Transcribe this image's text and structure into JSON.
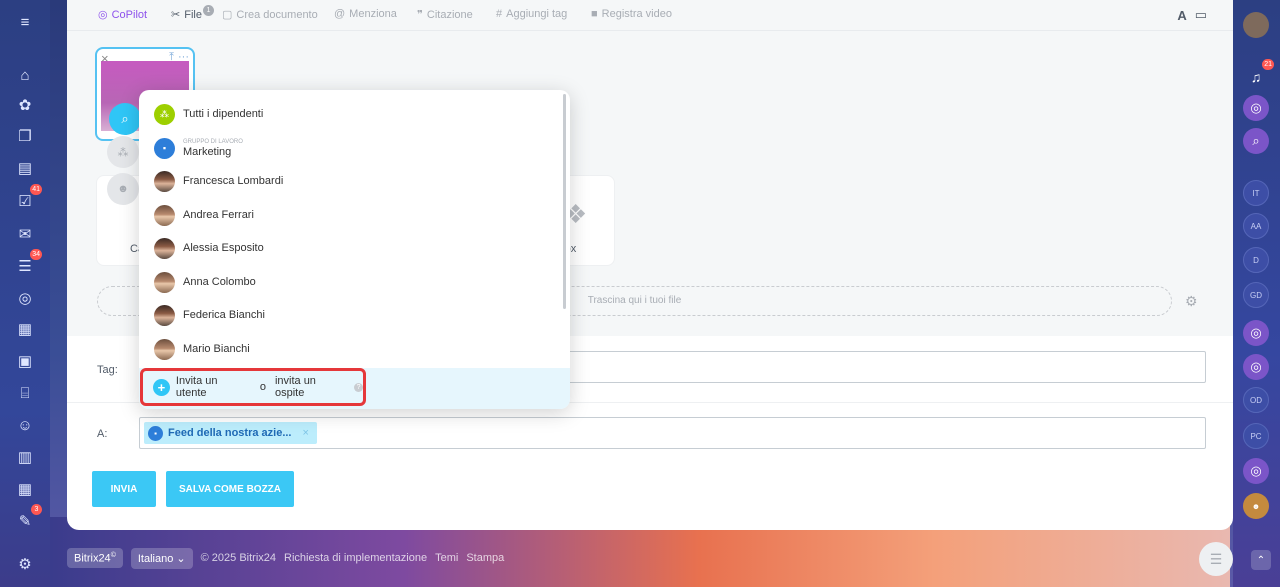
{
  "toolbar": {
    "copilot": "CoPilot",
    "file": "File",
    "file_count": "1",
    "create_doc": "Crea documento",
    "mention": "Menziona",
    "quote": "Citazione",
    "add_tag": "Aggiungi tag",
    "record_video": "Registra video",
    "font_btn": "A"
  },
  "attachments": {
    "upload_label_left": "Ca",
    "upload_label_right": "ɔbox",
    "dropzone": "Trascina qui i tuoi file"
  },
  "form": {
    "tag_label": "Tag:",
    "to_label": "A:",
    "to_chip": "Feed della nostra azie...",
    "send": "Invia",
    "save_draft": "Salva come bozza"
  },
  "popup": {
    "items": [
      {
        "label": "Tutti i dipendenti",
        "sub": ""
      },
      {
        "label": "Marketing",
        "sub": "GRUPPO DI LAVORO"
      },
      {
        "label": "Francesca Lombardi",
        "sub": ""
      },
      {
        "label": "Andrea Ferrari",
        "sub": ""
      },
      {
        "label": "Alessia Esposito",
        "sub": ""
      },
      {
        "label": "Anna Colombo",
        "sub": ""
      },
      {
        "label": "Federica Bianchi",
        "sub": ""
      },
      {
        "label": "Mario Bianchi",
        "sub": ""
      }
    ],
    "invite_user": "Invita un utente",
    "or": "o",
    "invite_guest": "invita un ospite"
  },
  "left_badges": {
    "tasks": "41",
    "filter": "34",
    "bottom": "3"
  },
  "right_sidebar": {
    "notify_badge": "21",
    "avatars": [
      "IT",
      "AA",
      "D",
      "GD",
      "OD",
      "PC"
    ]
  },
  "footer": {
    "brand": "Bitrix24",
    "brand_mark": "©",
    "language": "Italiano",
    "copyright": "© 2025 Bitrix24",
    "implementation": "Richiesta di implementazione",
    "themes": "Temi",
    "print": "Stampa"
  },
  "colors": {
    "accent": "#3bc8f5",
    "highlight": "#e5373a",
    "copilot": "#8e52ec"
  }
}
